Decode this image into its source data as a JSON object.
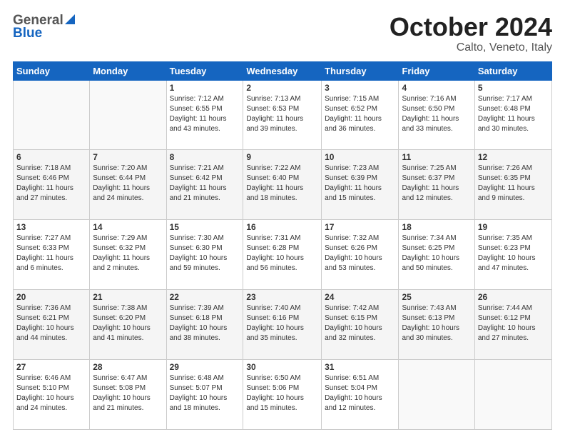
{
  "header": {
    "logo_general": "General",
    "logo_blue": "Blue",
    "month_title": "October 2024",
    "location": "Calto, Veneto, Italy"
  },
  "days_of_week": [
    "Sunday",
    "Monday",
    "Tuesday",
    "Wednesday",
    "Thursday",
    "Friday",
    "Saturday"
  ],
  "weeks": [
    [
      {
        "day": "",
        "sunrise": "",
        "sunset": "",
        "daylight": ""
      },
      {
        "day": "",
        "sunrise": "",
        "sunset": "",
        "daylight": ""
      },
      {
        "day": "1",
        "sunrise": "Sunrise: 7:12 AM",
        "sunset": "Sunset: 6:55 PM",
        "daylight": "Daylight: 11 hours and 43 minutes."
      },
      {
        "day": "2",
        "sunrise": "Sunrise: 7:13 AM",
        "sunset": "Sunset: 6:53 PM",
        "daylight": "Daylight: 11 hours and 39 minutes."
      },
      {
        "day": "3",
        "sunrise": "Sunrise: 7:15 AM",
        "sunset": "Sunset: 6:52 PM",
        "daylight": "Daylight: 11 hours and 36 minutes."
      },
      {
        "day": "4",
        "sunrise": "Sunrise: 7:16 AM",
        "sunset": "Sunset: 6:50 PM",
        "daylight": "Daylight: 11 hours and 33 minutes."
      },
      {
        "day": "5",
        "sunrise": "Sunrise: 7:17 AM",
        "sunset": "Sunset: 6:48 PM",
        "daylight": "Daylight: 11 hours and 30 minutes."
      }
    ],
    [
      {
        "day": "6",
        "sunrise": "Sunrise: 7:18 AM",
        "sunset": "Sunset: 6:46 PM",
        "daylight": "Daylight: 11 hours and 27 minutes."
      },
      {
        "day": "7",
        "sunrise": "Sunrise: 7:20 AM",
        "sunset": "Sunset: 6:44 PM",
        "daylight": "Daylight: 11 hours and 24 minutes."
      },
      {
        "day": "8",
        "sunrise": "Sunrise: 7:21 AM",
        "sunset": "Sunset: 6:42 PM",
        "daylight": "Daylight: 11 hours and 21 minutes."
      },
      {
        "day": "9",
        "sunrise": "Sunrise: 7:22 AM",
        "sunset": "Sunset: 6:40 PM",
        "daylight": "Daylight: 11 hours and 18 minutes."
      },
      {
        "day": "10",
        "sunrise": "Sunrise: 7:23 AM",
        "sunset": "Sunset: 6:39 PM",
        "daylight": "Daylight: 11 hours and 15 minutes."
      },
      {
        "day": "11",
        "sunrise": "Sunrise: 7:25 AM",
        "sunset": "Sunset: 6:37 PM",
        "daylight": "Daylight: 11 hours and 12 minutes."
      },
      {
        "day": "12",
        "sunrise": "Sunrise: 7:26 AM",
        "sunset": "Sunset: 6:35 PM",
        "daylight": "Daylight: 11 hours and 9 minutes."
      }
    ],
    [
      {
        "day": "13",
        "sunrise": "Sunrise: 7:27 AM",
        "sunset": "Sunset: 6:33 PM",
        "daylight": "Daylight: 11 hours and 6 minutes."
      },
      {
        "day": "14",
        "sunrise": "Sunrise: 7:29 AM",
        "sunset": "Sunset: 6:32 PM",
        "daylight": "Daylight: 11 hours and 2 minutes."
      },
      {
        "day": "15",
        "sunrise": "Sunrise: 7:30 AM",
        "sunset": "Sunset: 6:30 PM",
        "daylight": "Daylight: 10 hours and 59 minutes."
      },
      {
        "day": "16",
        "sunrise": "Sunrise: 7:31 AM",
        "sunset": "Sunset: 6:28 PM",
        "daylight": "Daylight: 10 hours and 56 minutes."
      },
      {
        "day": "17",
        "sunrise": "Sunrise: 7:32 AM",
        "sunset": "Sunset: 6:26 PM",
        "daylight": "Daylight: 10 hours and 53 minutes."
      },
      {
        "day": "18",
        "sunrise": "Sunrise: 7:34 AM",
        "sunset": "Sunset: 6:25 PM",
        "daylight": "Daylight: 10 hours and 50 minutes."
      },
      {
        "day": "19",
        "sunrise": "Sunrise: 7:35 AM",
        "sunset": "Sunset: 6:23 PM",
        "daylight": "Daylight: 10 hours and 47 minutes."
      }
    ],
    [
      {
        "day": "20",
        "sunrise": "Sunrise: 7:36 AM",
        "sunset": "Sunset: 6:21 PM",
        "daylight": "Daylight: 10 hours and 44 minutes."
      },
      {
        "day": "21",
        "sunrise": "Sunrise: 7:38 AM",
        "sunset": "Sunset: 6:20 PM",
        "daylight": "Daylight: 10 hours and 41 minutes."
      },
      {
        "day": "22",
        "sunrise": "Sunrise: 7:39 AM",
        "sunset": "Sunset: 6:18 PM",
        "daylight": "Daylight: 10 hours and 38 minutes."
      },
      {
        "day": "23",
        "sunrise": "Sunrise: 7:40 AM",
        "sunset": "Sunset: 6:16 PM",
        "daylight": "Daylight: 10 hours and 35 minutes."
      },
      {
        "day": "24",
        "sunrise": "Sunrise: 7:42 AM",
        "sunset": "Sunset: 6:15 PM",
        "daylight": "Daylight: 10 hours and 32 minutes."
      },
      {
        "day": "25",
        "sunrise": "Sunrise: 7:43 AM",
        "sunset": "Sunset: 6:13 PM",
        "daylight": "Daylight: 10 hours and 30 minutes."
      },
      {
        "day": "26",
        "sunrise": "Sunrise: 7:44 AM",
        "sunset": "Sunset: 6:12 PM",
        "daylight": "Daylight: 10 hours and 27 minutes."
      }
    ],
    [
      {
        "day": "27",
        "sunrise": "Sunrise: 6:46 AM",
        "sunset": "Sunset: 5:10 PM",
        "daylight": "Daylight: 10 hours and 24 minutes."
      },
      {
        "day": "28",
        "sunrise": "Sunrise: 6:47 AM",
        "sunset": "Sunset: 5:08 PM",
        "daylight": "Daylight: 10 hours and 21 minutes."
      },
      {
        "day": "29",
        "sunrise": "Sunrise: 6:48 AM",
        "sunset": "Sunset: 5:07 PM",
        "daylight": "Daylight: 10 hours and 18 minutes."
      },
      {
        "day": "30",
        "sunrise": "Sunrise: 6:50 AM",
        "sunset": "Sunset: 5:06 PM",
        "daylight": "Daylight: 10 hours and 15 minutes."
      },
      {
        "day": "31",
        "sunrise": "Sunrise: 6:51 AM",
        "sunset": "Sunset: 5:04 PM",
        "daylight": "Daylight: 10 hours and 12 minutes."
      },
      {
        "day": "",
        "sunrise": "",
        "sunset": "",
        "daylight": ""
      },
      {
        "day": "",
        "sunrise": "",
        "sunset": "",
        "daylight": ""
      }
    ]
  ]
}
